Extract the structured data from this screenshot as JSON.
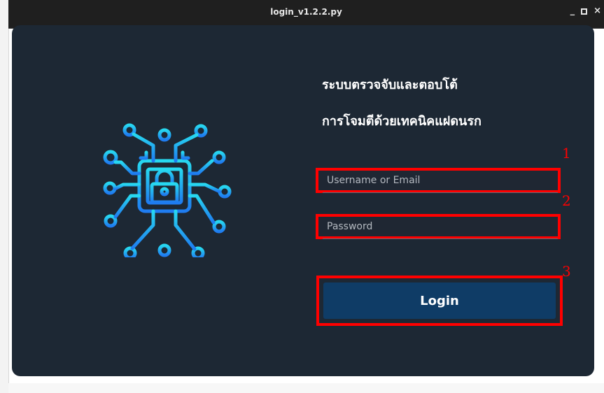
{
  "window": {
    "title": "login_v1.2.2.py",
    "controls": {
      "minimize": "_",
      "close": "×"
    }
  },
  "brand": {
    "logo_icon": "cyber-lock-circuit-icon",
    "heading_line_1": "ระบบตรวจจับและตอบโต้",
    "heading_line_2": "การโจมตีด้วยเทคนิคแฝดนรก"
  },
  "form": {
    "username_placeholder": "Username or Email",
    "password_placeholder": "Password",
    "login_label": "Login"
  },
  "callouts": [
    "1",
    "2",
    "3"
  ],
  "colors": {
    "panel_bg": "#1d2834",
    "field_bg": "#1f2733",
    "accent_cyan": "#27d8f0",
    "accent_blue": "#1f7cf0",
    "login_button": "#0f3c66",
    "highlight": "#ff0000"
  }
}
